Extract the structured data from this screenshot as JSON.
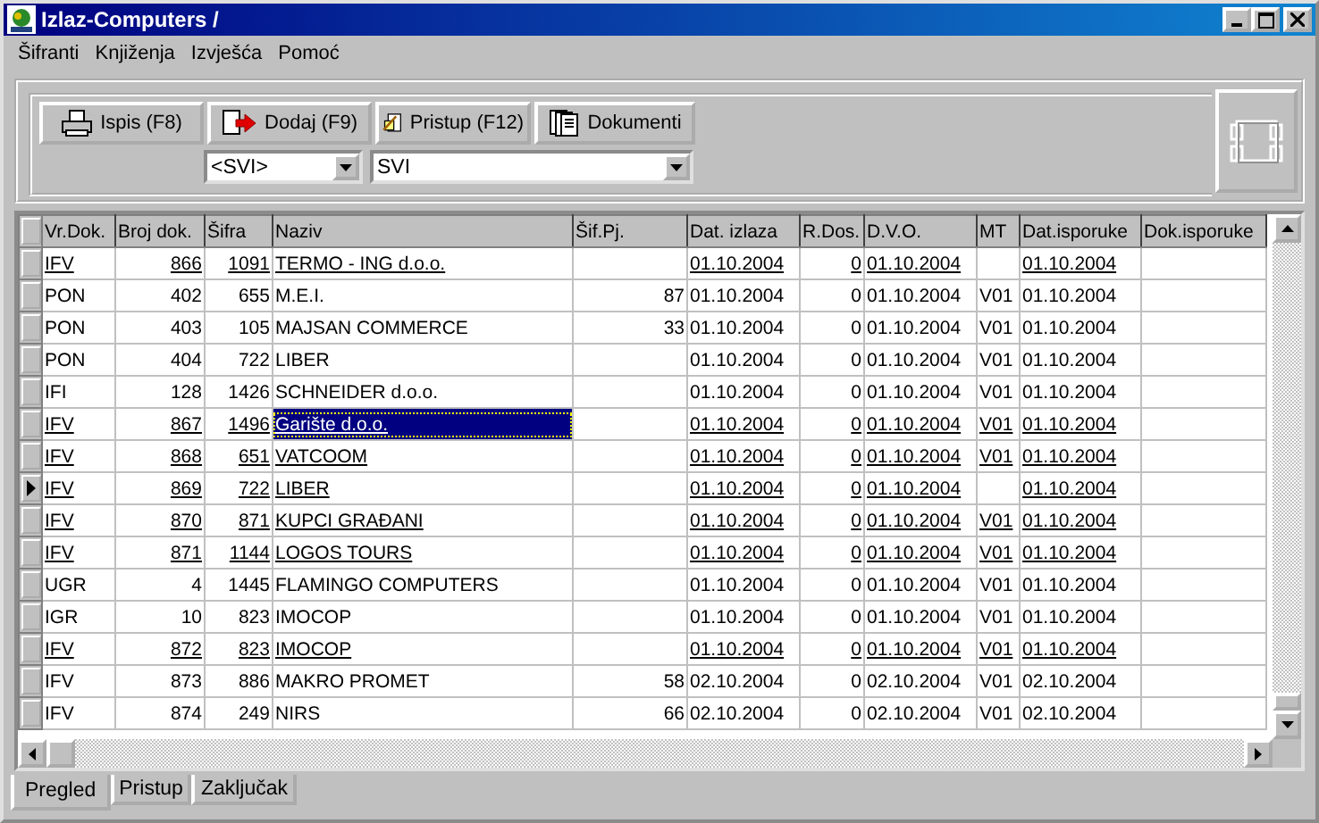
{
  "window": {
    "title": "Izlaz-Computers /"
  },
  "menu": [
    {
      "label": "Šifranti"
    },
    {
      "label": "Knjiženja"
    },
    {
      "label": "Izvješća"
    },
    {
      "label": "Pomoć"
    }
  ],
  "toolbar": {
    "buttons": [
      {
        "label": "Ispis (F8)",
        "kind": "print"
      },
      {
        "label": "Dodaj (F9)",
        "kind": "add"
      },
      {
        "label": "Pristup (F12)",
        "kind": "access"
      },
      {
        "label": "Dokumenti",
        "kind": "documents"
      }
    ],
    "filters": [
      {
        "value": "<SVI>"
      },
      {
        "value": "SVI"
      }
    ]
  },
  "table": {
    "columns": [
      "Vr.Dok.",
      "Broj dok.",
      "Šifra",
      "Naziv",
      "Šif.Pj.",
      "Dat. izlaza",
      "R.Dos.",
      "D.V.O.",
      "MT",
      "Dat.isporuke",
      "Dok.isporuke"
    ],
    "rows": [
      {
        "cells": [
          "IFV",
          "866",
          "1091",
          "TERMO - ING d.o.o.",
          null,
          "01.10.2004",
          "0",
          "01.10.2004",
          null,
          "01.10.2004",
          null
        ],
        "underlined": true,
        "selected": false,
        "current": false
      },
      {
        "cells": [
          "PON",
          "402",
          "655",
          "M.E.I.",
          "87",
          "01.10.2004",
          "0",
          "01.10.2004",
          "V01",
          "01.10.2004",
          null
        ],
        "underlined": false,
        "selected": false,
        "current": false
      },
      {
        "cells": [
          "PON",
          "403",
          "105",
          "MAJSAN COMMERCE",
          "33",
          "01.10.2004",
          "0",
          "01.10.2004",
          "V01",
          "01.10.2004",
          null
        ],
        "underlined": false,
        "selected": false,
        "current": false
      },
      {
        "cells": [
          "PON",
          "404",
          "722",
          "LIBER",
          null,
          "01.10.2004",
          "0",
          "01.10.2004",
          "V01",
          "01.10.2004",
          null
        ],
        "underlined": false,
        "selected": false,
        "current": false
      },
      {
        "cells": [
          "IFI",
          "128",
          "1426",
          "SCHNEIDER d.o.o.",
          null,
          "01.10.2004",
          "0",
          "01.10.2004",
          "V01",
          "01.10.2004",
          null
        ],
        "underlined": false,
        "selected": false,
        "current": false
      },
      {
        "cells": [
          "IFV",
          "867",
          "1496",
          "Garište d.o.o.",
          null,
          "01.10.2004",
          "0",
          "01.10.2004",
          "V01",
          "01.10.2004",
          null
        ],
        "underlined": true,
        "selected": true,
        "current": false
      },
      {
        "cells": [
          "IFV",
          "868",
          "651",
          "VATCOOM",
          null,
          "01.10.2004",
          "0",
          "01.10.2004",
          "V01",
          "01.10.2004",
          null
        ],
        "underlined": true,
        "selected": false,
        "current": false
      },
      {
        "cells": [
          "IFV",
          "869",
          "722",
          "LIBER",
          null,
          "01.10.2004",
          "0",
          "01.10.2004",
          null,
          "01.10.2004",
          null
        ],
        "underlined": true,
        "selected": false,
        "current": true
      },
      {
        "cells": [
          "IFV",
          "870",
          "871",
          "KUPCI GRAĐANI",
          null,
          "01.10.2004",
          "0",
          "01.10.2004",
          "V01",
          "01.10.2004",
          null
        ],
        "underlined": true,
        "selected": false,
        "current": false
      },
      {
        "cells": [
          "IFV",
          "871",
          "1144",
          "LOGOS TOURS",
          null,
          "01.10.2004",
          "0",
          "01.10.2004",
          "V01",
          "01.10.2004",
          null
        ],
        "underlined": true,
        "selected": false,
        "current": false
      },
      {
        "cells": [
          "UGR",
          "4",
          "1445",
          "FLAMINGO COMPUTERS",
          null,
          "01.10.2004",
          "0",
          "01.10.2004",
          "V01",
          "01.10.2004",
          null
        ],
        "underlined": false,
        "selected": false,
        "current": false
      },
      {
        "cells": [
          "IGR",
          "10",
          "823",
          "IMOCOP",
          null,
          "01.10.2004",
          "0",
          "01.10.2004",
          "V01",
          "01.10.2004",
          null
        ],
        "underlined": false,
        "selected": false,
        "current": false
      },
      {
        "cells": [
          "IFV",
          "872",
          "823",
          "IMOCOP",
          null,
          "01.10.2004",
          "0",
          "01.10.2004",
          "V01",
          "01.10.2004",
          null
        ],
        "underlined": true,
        "selected": false,
        "current": false
      },
      {
        "cells": [
          "IFV",
          "873",
          "886",
          "MAKRO PROMET",
          "58",
          "02.10.2004",
          "0",
          "02.10.2004",
          "V01",
          "02.10.2004",
          null
        ],
        "underlined": false,
        "selected": false,
        "current": false
      },
      {
        "cells": [
          "IFV",
          "874",
          "249",
          "NIRS",
          "66",
          "02.10.2004",
          "0",
          "02.10.2004",
          "V01",
          "02.10.2004",
          null
        ],
        "underlined": false,
        "selected": false,
        "current": false
      }
    ]
  },
  "tabs": [
    {
      "label": "Pregled",
      "selected": true
    },
    {
      "label": "Pristup",
      "selected": false
    },
    {
      "label": "Zaključak",
      "selected": false
    }
  ]
}
